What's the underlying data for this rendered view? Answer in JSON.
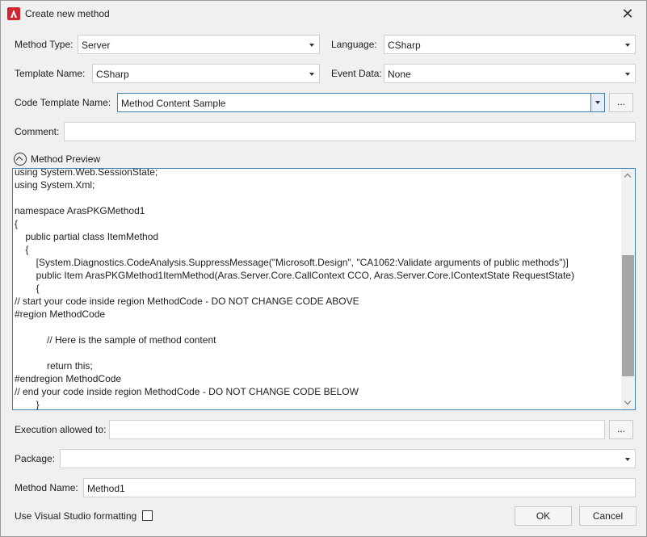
{
  "window": {
    "title": "Create new method",
    "close_icon": "close-icon"
  },
  "form": {
    "method_type_label": "Method Type:",
    "method_type_value": "Server",
    "language_label": "Language:",
    "language_value": "CSharp",
    "template_name_label": "Template Name:",
    "template_name_value": "CSharp",
    "event_data_label": "Event Data:",
    "event_data_value": "None",
    "code_template_label": "Code Template Name:",
    "code_template_value": "Method Content Sample",
    "browse_label": "...",
    "comment_label": "Comment:",
    "comment_value": ""
  },
  "preview": {
    "header": "Method Preview",
    "code": "using System.Web.SessionState;\nusing System.Xml;\n\nnamespace ArasPKGMethod1\n{\n    public partial class ItemMethod\n    {\n        [System.Diagnostics.CodeAnalysis.SuppressMessage(\"Microsoft.Design\", \"CA1062:Validate arguments of public methods\")]\n        public Item ArasPKGMethod1ItemMethod(Aras.Server.Core.CallContext CCO, Aras.Server.Core.IContextState RequestState)\n        {\n// start your code inside region MethodCode - DO NOT CHANGE CODE ABOVE\n#region MethodCode\n\n            // Here is the sample of method content\n\n            return this;\n#endregion MethodCode\n// end your code inside region MethodCode - DO NOT CHANGE CODE BELOW\n        }"
  },
  "bottom": {
    "execution_label": "Execution allowed to:",
    "execution_value": "",
    "execution_browse": "...",
    "package_label": "Package:",
    "package_value": "",
    "method_name_label": "Method Name:",
    "method_name_value": "Method1",
    "vs_format_label": "Use Visual Studio formatting",
    "vs_format_checked": false,
    "ok_label": "OK",
    "cancel_label": "Cancel"
  },
  "colors": {
    "accent_border": "#3c7fb1",
    "app_icon": "#d0262f"
  }
}
